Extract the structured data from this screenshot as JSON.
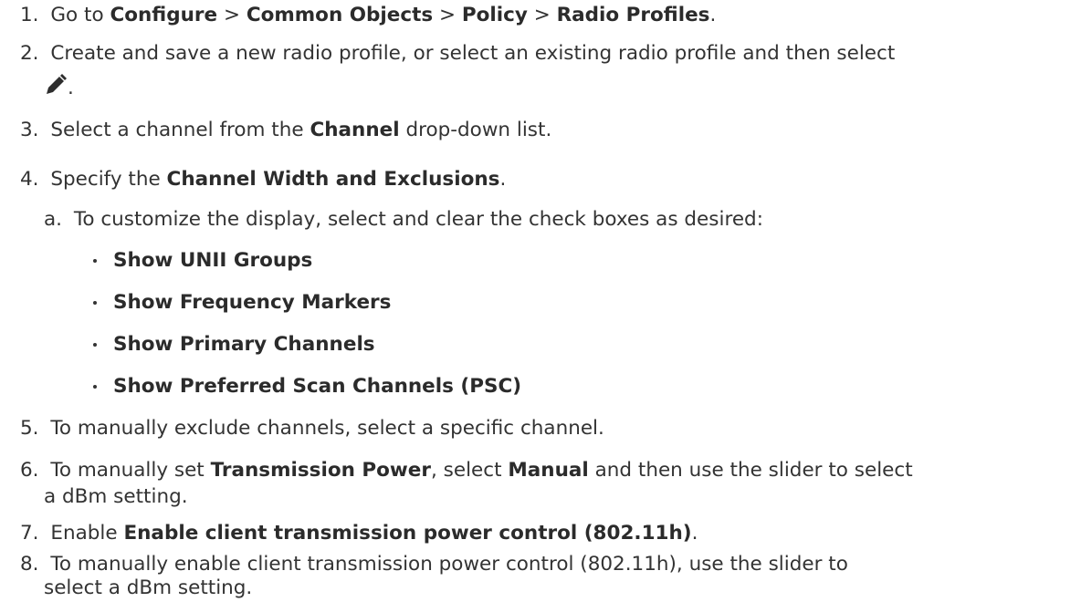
{
  "steps": [
    {
      "num": "1.",
      "p1": "Go to ",
      "b1": "Configure",
      "p2": " > ",
      "b2": "Common Objects",
      "p3": " > ",
      "b3": "Policy",
      "p4": " > ",
      "b4": "Radio Profiles",
      "p5": "."
    },
    {
      "num": "2.",
      "line1": "Create and save a new radio profile, or select an existing radio profile and then select",
      "line2_end": "."
    },
    {
      "num": "3.",
      "p1": "Select a channel from the ",
      "b1": "Channel",
      "p2": " drop-down list."
    },
    {
      "num": "4.",
      "p1": "Specify the ",
      "b1": "Channel Width and Exclusions",
      "p2": "."
    },
    {
      "num": "5.",
      "text": "To manually exclude channels, select a specific channel."
    },
    {
      "num": "6.",
      "p1": "To manually set ",
      "b1": "Transmission Power",
      "p2": ", select ",
      "b2": "Manual",
      "p3": " and then use the slider to select",
      "line2": "a dBm setting."
    },
    {
      "num": "7.",
      "p1": "Enable ",
      "b1": "Enable client transmission power control (802.11h)",
      "p2": "."
    },
    {
      "num": "8.",
      "line1": "To manually enable client transmission power control (802.11h), use the slider to",
      "line2": "select a dBm setting."
    }
  ],
  "substep": {
    "letter": "a.",
    "text": "To customize the display, select and clear the check boxes as desired:",
    "options": [
      "Show UNII Groups",
      "Show Frequency Markers",
      "Show Primary Channels",
      "Show Preferred Scan Channels (PSC)"
    ]
  },
  "icons": {
    "edit": "pencil-icon"
  }
}
